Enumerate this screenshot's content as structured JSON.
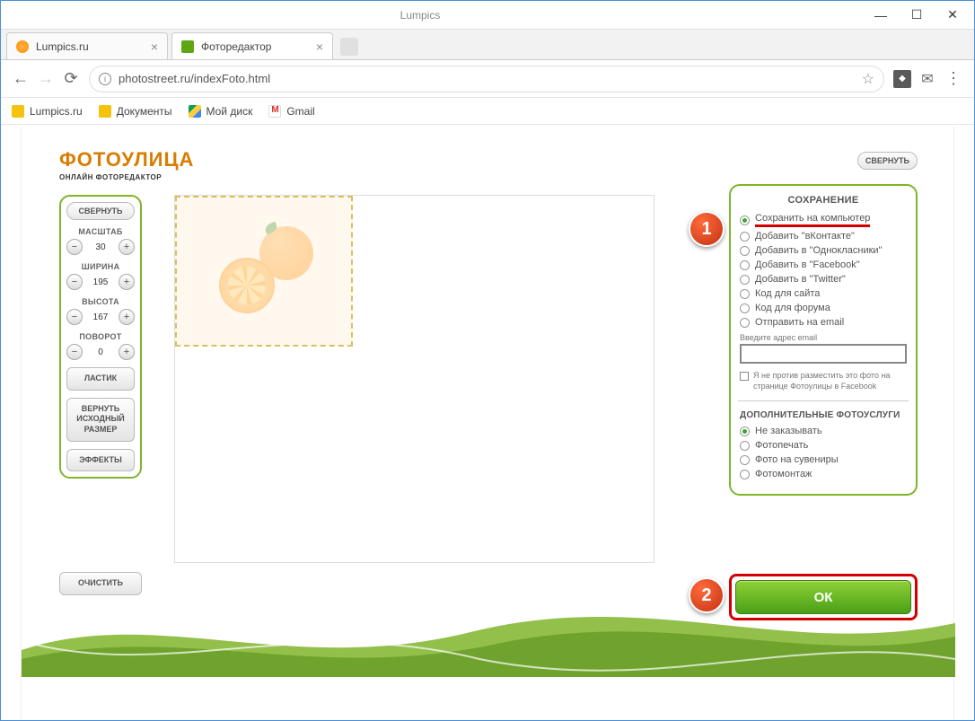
{
  "window": {
    "app_label": "Lumpics"
  },
  "tabs": [
    {
      "title": "Lumpics.ru"
    },
    {
      "title": "Фоторедактор"
    }
  ],
  "url": "photostreet.ru/indexFoto.html",
  "bookmarks": [
    {
      "label": "Lumpics.ru"
    },
    {
      "label": "Документы"
    },
    {
      "label": "Мой диск"
    },
    {
      "label": "Gmail"
    }
  ],
  "logo": {
    "main": "ФОТОУЛИЦА",
    "sub": "ОНЛАЙН ФОТОРЕДАКТОР"
  },
  "top_collapse": "СВЕРНУТЬ",
  "left": {
    "collapse": "СВЕРНУТЬ",
    "scale": {
      "label": "МАСШТАБ",
      "value": "30"
    },
    "width": {
      "label": "ШИРИНА",
      "value": "195"
    },
    "height": {
      "label": "ВЫСОТА",
      "value": "167"
    },
    "rotate": {
      "label": "ПОВОРОТ",
      "value": "0"
    },
    "eraser": "ЛАСТИК",
    "reset": "ВЕРНУТЬ ИСХОДНЫЙ РАЗМЕР",
    "effects": "ЭФФЕКТЫ",
    "clear": "ОЧИСТИТЬ"
  },
  "save_panel": {
    "title": "СОХРАНЕНИЕ",
    "options": [
      "Сохранить на компьютер",
      "Добавить \"вКонтакте\"",
      "Добавить в \"Однокласники\"",
      "Добавить в \"Facebook\"",
      "Добавить в \"Twitter\"",
      "Код для сайта",
      "Код для форума",
      "Отправить на email"
    ],
    "email_label": "Введите адрес email",
    "consent": "Я не против разместить это фото на странице Фотоулицы в Facebook",
    "extra_title": "ДОПОЛНИТЕЛЬНЫЕ ФОТОУСЛУГИ",
    "extra_options": [
      "Не заказывать",
      "Фотопечать",
      "Фото на сувениры",
      "Фотомонтаж"
    ]
  },
  "ok_label": "ОК",
  "steps": {
    "s1": "1",
    "s2": "2"
  }
}
